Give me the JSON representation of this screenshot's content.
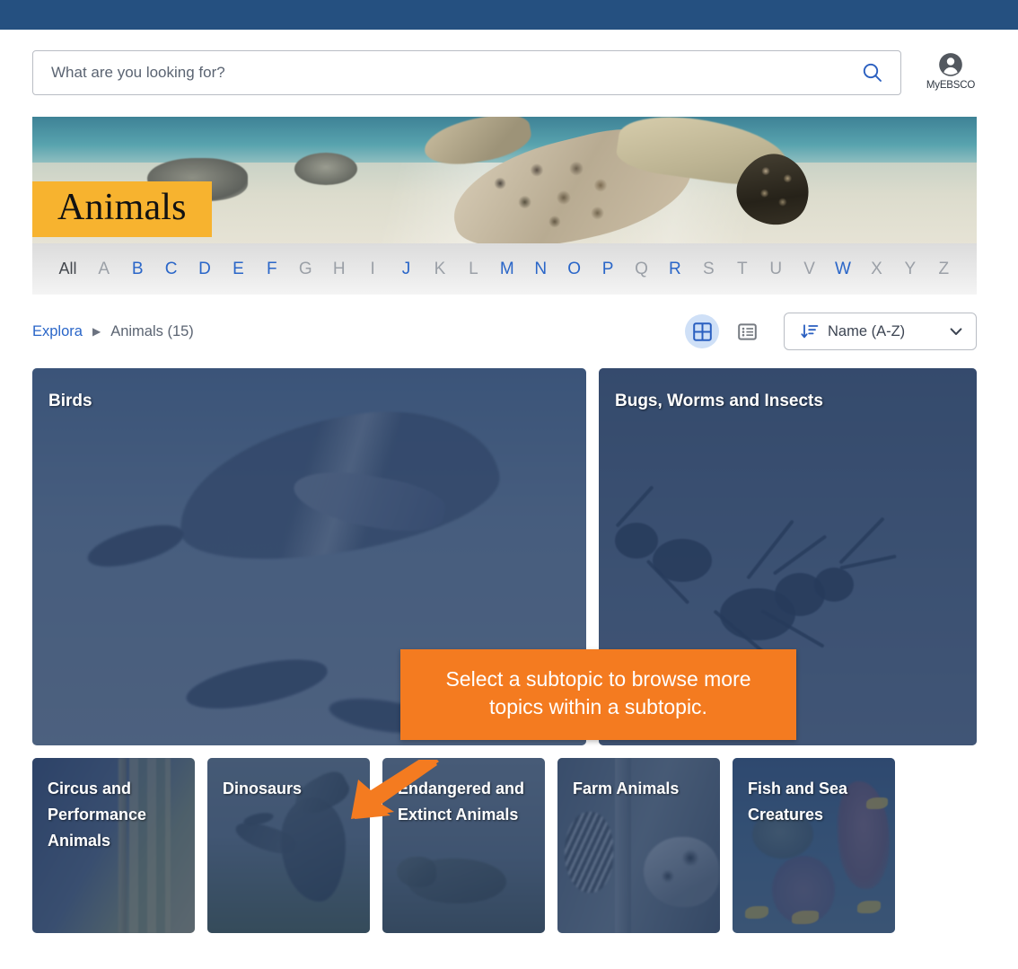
{
  "header": {
    "bar_color": "#255080"
  },
  "search": {
    "placeholder": "What are you looking for?",
    "value": "",
    "search_icon": "search-icon",
    "account_label": "MyEBSCO",
    "account_icon": "account-circle-icon"
  },
  "banner": {
    "title": "Animals",
    "label_color": "#f7b32f",
    "image_description": "sea turtle swimming over sandy seafloor"
  },
  "alphabet": {
    "items": [
      {
        "label": "All",
        "active": true,
        "is_all": true
      },
      {
        "label": "A",
        "active": false
      },
      {
        "label": "B",
        "active": true
      },
      {
        "label": "C",
        "active": true
      },
      {
        "label": "D",
        "active": true
      },
      {
        "label": "E",
        "active": true
      },
      {
        "label": "F",
        "active": true
      },
      {
        "label": "G",
        "active": false
      },
      {
        "label": "H",
        "active": false
      },
      {
        "label": "I",
        "active": false
      },
      {
        "label": "J",
        "active": true
      },
      {
        "label": "K",
        "active": false
      },
      {
        "label": "L",
        "active": false
      },
      {
        "label": "M",
        "active": true
      },
      {
        "label": "N",
        "active": true
      },
      {
        "label": "O",
        "active": true
      },
      {
        "label": "P",
        "active": true
      },
      {
        "label": "Q",
        "active": false
      },
      {
        "label": "R",
        "active": true
      },
      {
        "label": "S",
        "active": false
      },
      {
        "label": "T",
        "active": false
      },
      {
        "label": "U",
        "active": false
      },
      {
        "label": "V",
        "active": false
      },
      {
        "label": "W",
        "active": true
      },
      {
        "label": "X",
        "active": false
      },
      {
        "label": "Y",
        "active": false
      },
      {
        "label": "Z",
        "active": false
      }
    ],
    "active_color": "#2a66c8",
    "inactive_color": "#9ba0a7"
  },
  "breadcrumb": {
    "root": "Explora",
    "separator": "▶",
    "current": "Animals (15)"
  },
  "controls": {
    "grid_view_icon": "grid-view-icon",
    "list_view_icon": "list-view-icon",
    "grid_view_active": true,
    "sort_icon": "sort-descending-icon",
    "sort_value": "Name (A-Z)",
    "chevron_icon": "chevron-down-icon"
  },
  "topics": {
    "row1": [
      {
        "title": "Birds"
      },
      {
        "title": "Bugs, Worms and Insects"
      }
    ],
    "row2": [
      {
        "title": "Circus and Performance Animals"
      },
      {
        "title": "Dinosaurs"
      },
      {
        "title": "Endangered and Extinct Animals"
      },
      {
        "title": "Farm Animals"
      },
      {
        "title": "Fish and Sea Creatures"
      }
    ]
  },
  "callout": {
    "text": "Select a subtopic to browse more topics within a subtopic.",
    "color": "#f47b20",
    "arrow_icon": "arrow-pointer-icon"
  }
}
